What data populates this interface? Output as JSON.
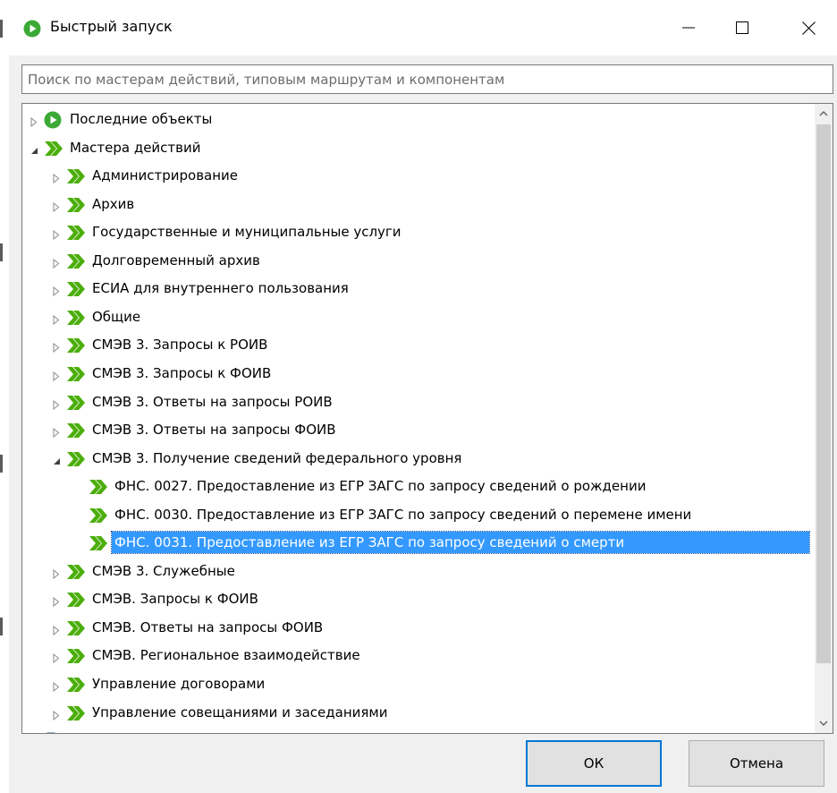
{
  "window": {
    "title": "Быстрый запуск",
    "controls": {
      "minimize_icon": "minimize-icon",
      "maximize_icon": "maximize-icon",
      "close_icon": "close-icon"
    }
  },
  "search": {
    "placeholder": "Поиск по мастерам действий, типовым маршрутам и компонентам",
    "value": ""
  },
  "tree": {
    "items": [
      {
        "label": "Последние объекты",
        "level": 0,
        "expander": "collapsed",
        "icon": "play-icon"
      },
      {
        "label": "Мастера действий",
        "level": 0,
        "expander": "expanded",
        "icon": "wizard-icon"
      },
      {
        "label": "Администрирование",
        "level": 1,
        "expander": "collapsed",
        "icon": "wizard-icon"
      },
      {
        "label": "Архив",
        "level": 1,
        "expander": "collapsed",
        "icon": "wizard-icon"
      },
      {
        "label": "Государственные и муниципальные услуги",
        "level": 1,
        "expander": "collapsed",
        "icon": "wizard-icon"
      },
      {
        "label": "Долговременный архив",
        "level": 1,
        "expander": "collapsed",
        "icon": "wizard-icon"
      },
      {
        "label": "ЕСИА для внутреннего пользования",
        "level": 1,
        "expander": "collapsed",
        "icon": "wizard-icon"
      },
      {
        "label": "Общие",
        "level": 1,
        "expander": "collapsed",
        "icon": "wizard-icon"
      },
      {
        "label": "СМЭВ 3. Запросы к РОИВ",
        "level": 1,
        "expander": "collapsed",
        "icon": "wizard-icon"
      },
      {
        "label": "СМЭВ 3. Запросы к ФОИВ",
        "level": 1,
        "expander": "collapsed",
        "icon": "wizard-icon"
      },
      {
        "label": "СМЭВ 3. Ответы на запросы РОИВ",
        "level": 1,
        "expander": "collapsed",
        "icon": "wizard-icon"
      },
      {
        "label": "СМЭВ 3. Ответы на запросы ФОИВ",
        "level": 1,
        "expander": "collapsed",
        "icon": "wizard-icon"
      },
      {
        "label": "СМЭВ 3. Получение сведений федерального уровня",
        "level": 1,
        "expander": "expanded",
        "icon": "wizard-icon"
      },
      {
        "label": "ФНС. 0027. Предоставление из ЕГР ЗАГС по запросу сведений о рождении",
        "level": 2,
        "expander": "none",
        "icon": "wizard-icon"
      },
      {
        "label": "ФНС. 0030. Предоставление из ЕГР ЗАГС по запросу сведений о перемене имени",
        "level": 2,
        "expander": "none",
        "icon": "wizard-icon"
      },
      {
        "label": "ФНС. 0031. Предоставление из ЕГР ЗАГС по запросу сведений о смерти",
        "level": 2,
        "expander": "none",
        "icon": "wizard-icon",
        "selected": true
      },
      {
        "label": "СМЭВ 3. Служебные",
        "level": 1,
        "expander": "collapsed",
        "icon": "wizard-icon"
      },
      {
        "label": "СМЭВ. Запросы к ФОИВ",
        "level": 1,
        "expander": "collapsed",
        "icon": "wizard-icon"
      },
      {
        "label": "СМЭВ. Ответы на запросы ФОИВ",
        "level": 1,
        "expander": "collapsed",
        "icon": "wizard-icon"
      },
      {
        "label": "СМЭВ. Региональное взаимодействие",
        "level": 1,
        "expander": "collapsed",
        "icon": "wizard-icon"
      },
      {
        "label": "Управление договорами",
        "level": 1,
        "expander": "collapsed",
        "icon": "wizard-icon"
      },
      {
        "label": "Управление совещаниями и заседаниями",
        "level": 1,
        "expander": "collapsed",
        "icon": "wizard-icon"
      },
      {
        "label": "Т",
        "level": 0,
        "expander": "collapsed",
        "icon": "component-icon",
        "partial": true
      }
    ]
  },
  "buttons": {
    "ok_label": "ОК",
    "cancel_label": "Отмена"
  },
  "colors": {
    "selection": "#3399ff",
    "wizard_green": "#4cae0b",
    "play_green": "#3aa935",
    "ok_border": "#0078d7"
  }
}
